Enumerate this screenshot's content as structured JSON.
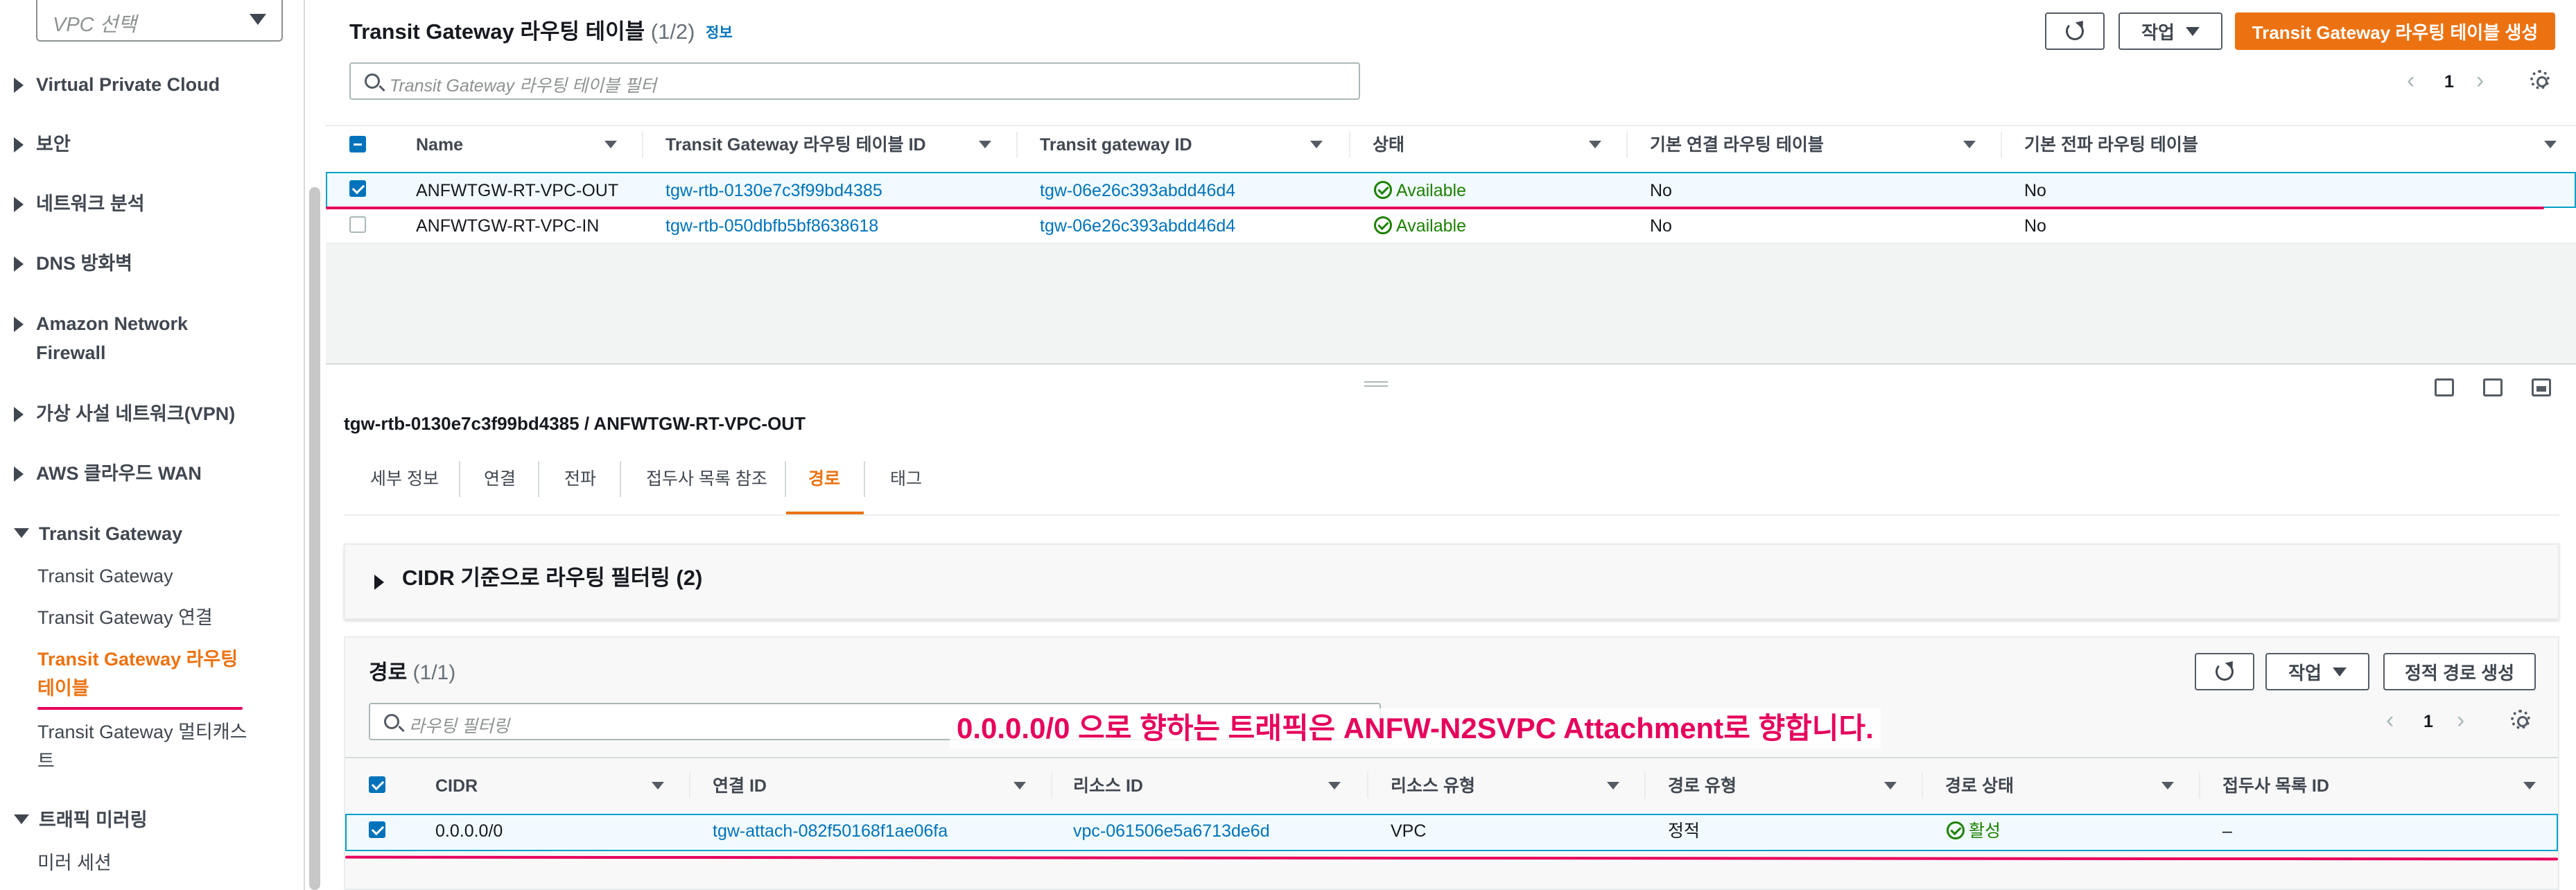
{
  "sidebar": {
    "vpc_select_placeholder": "VPC 선택",
    "sections": [
      {
        "label": "Virtual Private Cloud"
      },
      {
        "label": "보안"
      },
      {
        "label": "네트워크 분석"
      },
      {
        "label": "DNS 방화벽"
      },
      {
        "label_line1": "Amazon Network",
        "label_line2": "Firewall"
      },
      {
        "label": "가상 사설 네트워크(VPN)"
      },
      {
        "label": "AWS 클라우드 WAN"
      },
      {
        "label": "Transit Gateway"
      },
      {
        "label": "트래픽 미러링"
      }
    ],
    "tgw_items": [
      {
        "label": "Transit Gateway"
      },
      {
        "label": "Transit Gateway 연결"
      },
      {
        "label_line1": "Transit Gateway 라우팅",
        "label_line2": "테이블"
      },
      {
        "label_line1": "Transit Gateway 멀티캐스",
        "label_line2": "트"
      }
    ],
    "mirror_items": [
      {
        "label": "미러 세션"
      }
    ]
  },
  "top": {
    "title": "Transit Gateway 라우팅 테이블",
    "count": "(1/2)",
    "info": "정보",
    "actions_label": "작업",
    "create_label": "Transit Gateway 라우팅 테이블 생성",
    "search_placeholder": "Transit Gateway 라우팅 테이블 필터",
    "page": "1",
    "columns": [
      "Name",
      "Transit Gateway 라우팅 테이블 ID",
      "Transit gateway ID",
      "상태",
      "기본 연결 라우팅 테이블",
      "기본 전파 라우팅 테이블"
    ],
    "rows": [
      {
        "name": "ANFWTGW-RT-VPC-OUT",
        "rtb": "tgw-rtb-0130e7c3f99bd4385",
        "tgw": "tgw-06e26c393abdd46d4",
        "status": "Available",
        "assoc": "No",
        "prop": "No"
      },
      {
        "name": "ANFWTGW-RT-VPC-IN",
        "rtb": "tgw-rtb-050dbfb5bf8638618",
        "tgw": "tgw-06e26c393abdd46d4",
        "status": "Available",
        "assoc": "No",
        "prop": "No"
      }
    ]
  },
  "detail": {
    "heading": "tgw-rtb-0130e7c3f99bd4385 / ANFWTGW-RT-VPC-OUT",
    "tabs": [
      "세부 정보",
      "연결",
      "전파",
      "접두사 목록 참조",
      "경로",
      "태그"
    ],
    "cidr_filter": "CIDR 기준으로 라우팅 필터링 (2)",
    "routes_title": "경로",
    "routes_count": "(1/1)",
    "actions_label": "작업",
    "create_static": "정적 경로 생성",
    "route_search_placeholder": "라우팅 필터링",
    "page": "1",
    "columns": [
      "CIDR",
      "연결 ID",
      "리소스 ID",
      "리소스 유형",
      "경로 유형",
      "경로 상태",
      "접두사 목록 ID"
    ],
    "rows": [
      {
        "cidr": "0.0.0.0/0",
        "attach": "tgw-attach-082f50168f1ae06fa",
        "resource": "vpc-061506e5a6713de6d",
        "rtype": "VPC",
        "route_type": "정적",
        "state": "활성",
        "prefix": "–"
      }
    ]
  },
  "annotation": "0.0.0.0/0 으로 향하는 트래픽은 ANFW-N2SVPC Attachment로 향합니다.",
  "colors": {
    "accent": "#ec7211",
    "link": "#0073bb",
    "success": "#1d8102",
    "highlight": "#e6005c"
  }
}
